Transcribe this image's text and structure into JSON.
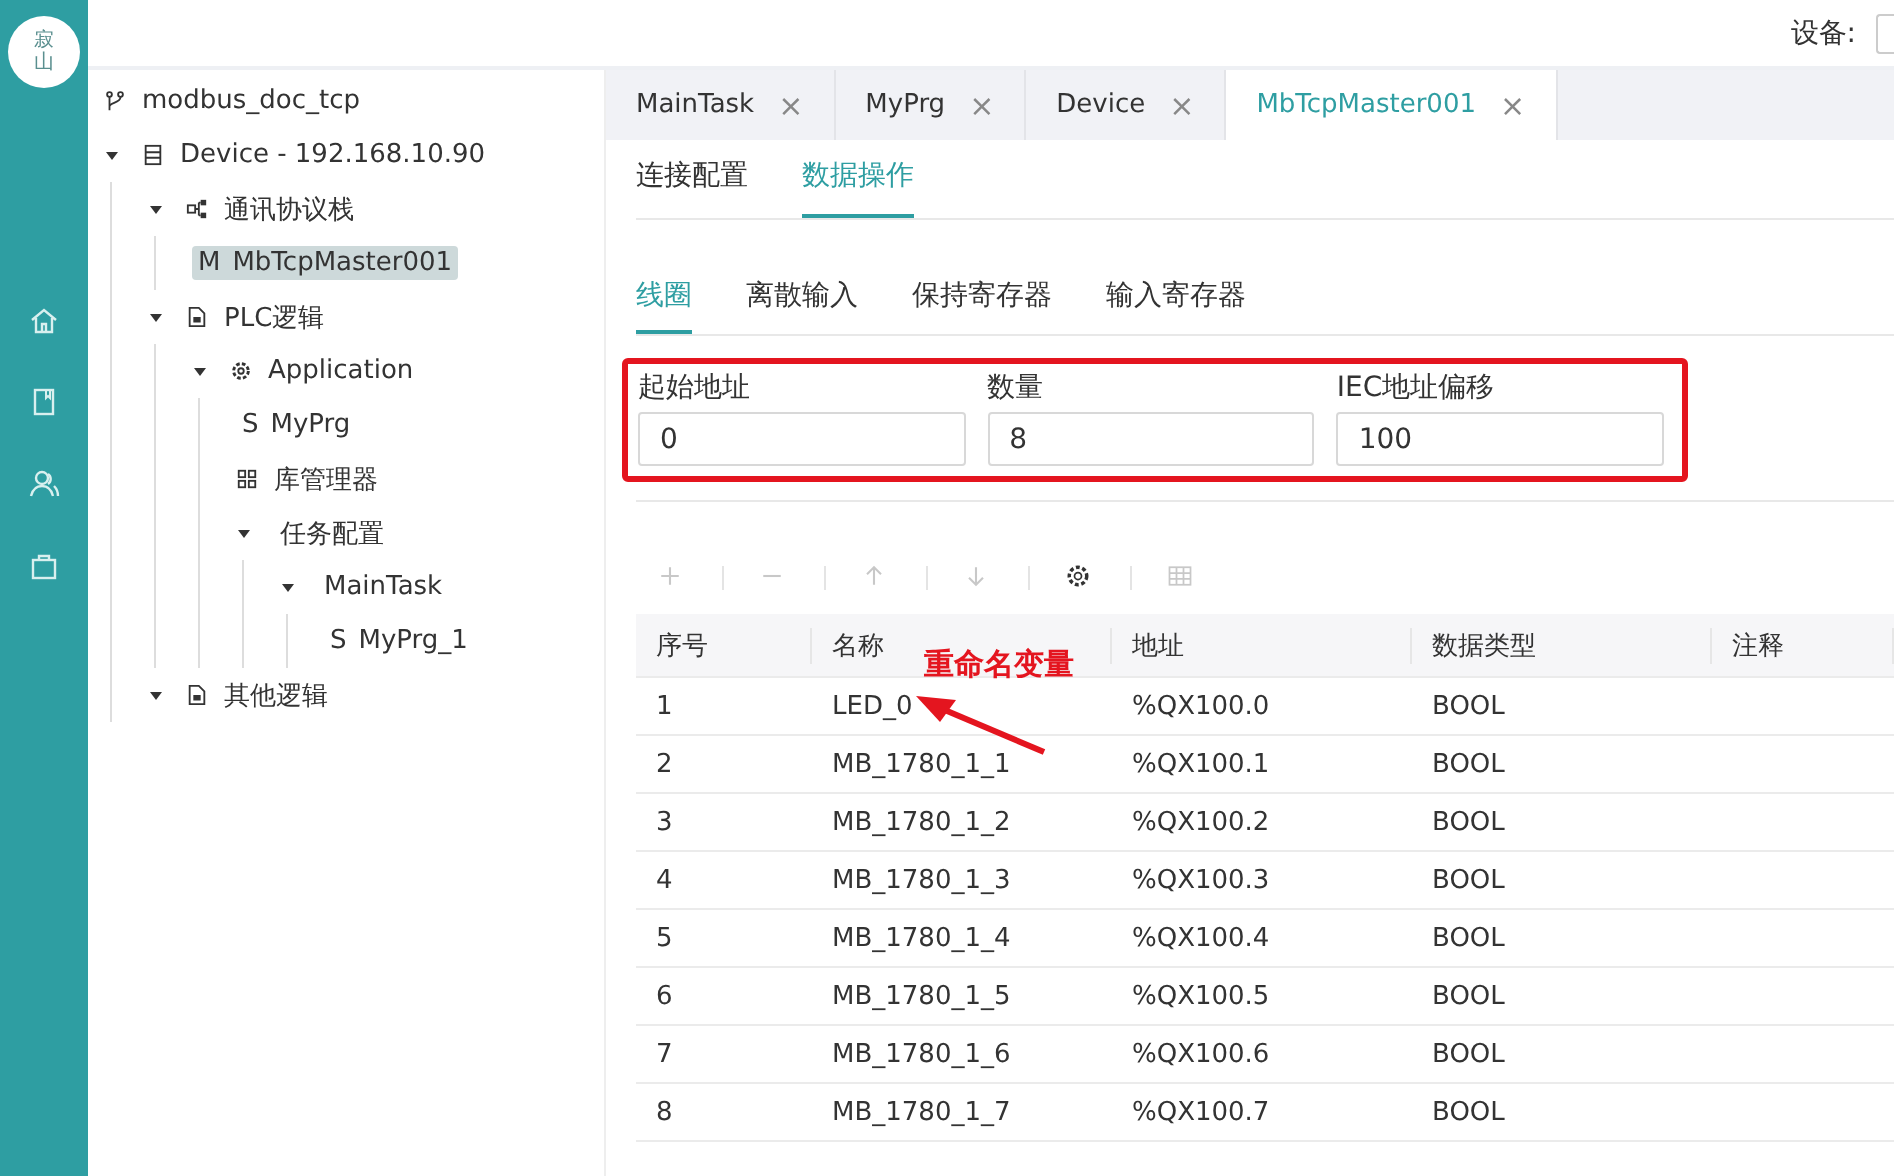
{
  "logo_text": "寂山",
  "rail": [
    {
      "kind": "home"
    },
    {
      "kind": "book"
    },
    {
      "kind": "users"
    },
    {
      "kind": "bag"
    }
  ],
  "top_bar": {
    "device_label": "设备:"
  },
  "tree": [
    {
      "kind": "project",
      "label": "modbus_doc_tcp",
      "selected": false,
      "children": [
        {
          "kind": "device",
          "label": "Device - 192.168.10.90",
          "expanded": true,
          "selected": false,
          "children": [
            {
              "kind": "stack",
              "label": "通讯协议栈",
              "expanded": true,
              "selected": false,
              "children": [
                {
                  "prefix": "M",
                  "label": "MbTcpMaster001",
                  "selected": true
                }
              ]
            },
            {
              "kind": "file",
              "label": "PLC逻辑",
              "expanded": true,
              "selected": false,
              "children": [
                {
                  "kind": "app",
                  "label": "Application",
                  "expanded": true,
                  "selected": false,
                  "children": [
                    {
                      "prefix": "S",
                      "label": "MyPrg",
                      "selected": false
                    },
                    {
                      "kind": "library",
                      "label": "库管理器",
                      "selected": false
                    },
                    {
                      "label": "任务配置",
                      "expanded": true,
                      "selected": false,
                      "children": [
                        {
                          "label": "MainTask",
                          "expanded": true,
                          "selected": false,
                          "children": [
                            {
                              "prefix": "S",
                              "label": "MyPrg_1",
                              "selected": false
                            }
                          ]
                        }
                      ]
                    }
                  ]
                }
              ]
            },
            {
              "kind": "file",
              "label": "其他逻辑",
              "expanded": true,
              "selected": false
            }
          ]
        }
      ]
    }
  ],
  "tabs": [
    {
      "label": "MainTask",
      "close": "×",
      "selected": false
    },
    {
      "label": "MyPrg",
      "close": "×",
      "selected": false
    },
    {
      "label": "Device",
      "close": "×",
      "selected": false
    },
    {
      "label": "MbTcpMaster001",
      "close": "×",
      "selected": true
    }
  ],
  "subtabs": [
    {
      "label": "连接配置",
      "selected": false
    },
    {
      "label": "数据操作",
      "selected": true
    }
  ],
  "register_tabs": [
    {
      "label": "线圈",
      "selected": true
    },
    {
      "label": "离散输入",
      "selected": false
    },
    {
      "label": "保持寄存器",
      "selected": false
    },
    {
      "label": "输入寄存器",
      "selected": false
    }
  ],
  "fields": [
    {
      "label": "起始地址",
      "value": "0"
    },
    {
      "label": "数量",
      "value": "8"
    },
    {
      "label": "IEC地址偏移",
      "value": "100"
    }
  ],
  "toolbar": [
    {
      "kind": "add",
      "disabled": true
    },
    {
      "kind": "remove",
      "disabled": true
    },
    {
      "kind": "up",
      "disabled": true
    },
    {
      "kind": "down",
      "disabled": true
    },
    {
      "kind": "settings",
      "disabled": false
    },
    {
      "kind": "table",
      "disabled": true
    }
  ],
  "table": {
    "columns": [
      "序号",
      "名称",
      "地址",
      "数据类型",
      "注释"
    ],
    "rows": [
      [
        "1",
        "LED_0",
        "%QX100.0",
        "BOOL",
        ""
      ],
      [
        "2",
        "MB_1780_1_1",
        "%QX100.1",
        "BOOL",
        ""
      ],
      [
        "3",
        "MB_1780_1_2",
        "%QX100.2",
        "BOOL",
        ""
      ],
      [
        "4",
        "MB_1780_1_3",
        "%QX100.3",
        "BOOL",
        ""
      ],
      [
        "5",
        "MB_1780_1_4",
        "%QX100.4",
        "BOOL",
        ""
      ],
      [
        "6",
        "MB_1780_1_5",
        "%QX100.5",
        "BOOL",
        ""
      ],
      [
        "7",
        "MB_1780_1_6",
        "%QX100.6",
        "BOOL",
        ""
      ],
      [
        "8",
        "MB_1780_1_7",
        "%QX100.7",
        "BOOL",
        ""
      ]
    ]
  },
  "annotation": {
    "text": "重命名变量"
  }
}
